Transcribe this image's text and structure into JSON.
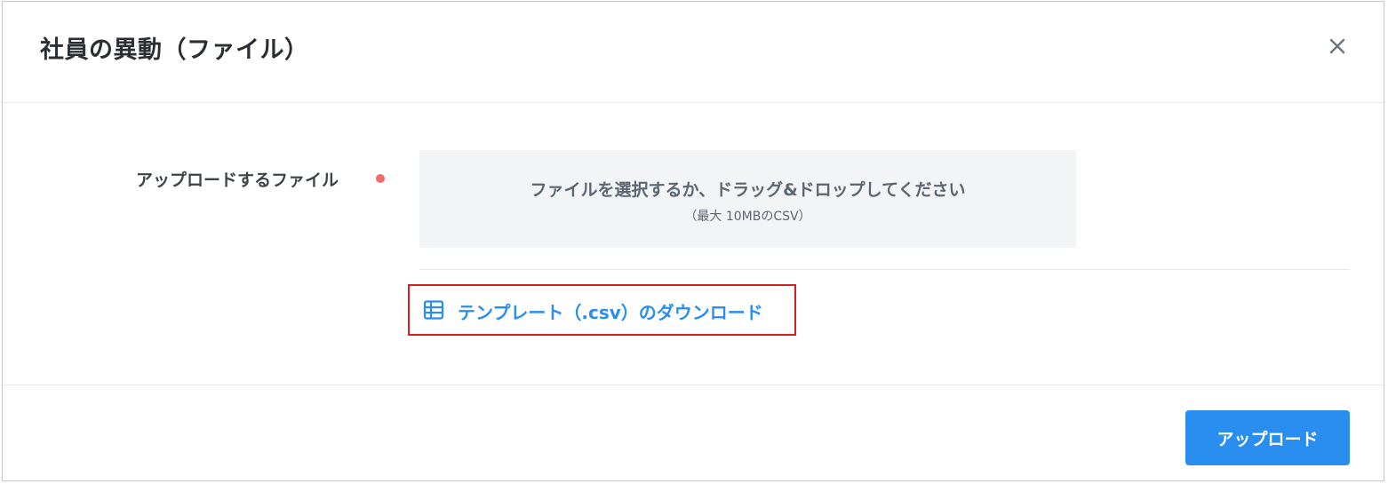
{
  "dialog": {
    "title": "社員の異動（ファイル）",
    "close_icon": "close-icon"
  },
  "form": {
    "file_label": "アップロードするファイル",
    "required_color": "#f26b6b",
    "dropzone": {
      "main_text": "ファイルを選択するか、ドラッグ&ドロップしてください",
      "sub_text": "（最大 10MBのCSV）"
    },
    "template_link": {
      "icon": "table-icon",
      "label": "テンプレート（.csv）のダウンロード"
    }
  },
  "footer": {
    "upload_label": "アップロード"
  },
  "colors": {
    "accent": "#2a8ef0",
    "highlight_border": "#d81e1e"
  }
}
